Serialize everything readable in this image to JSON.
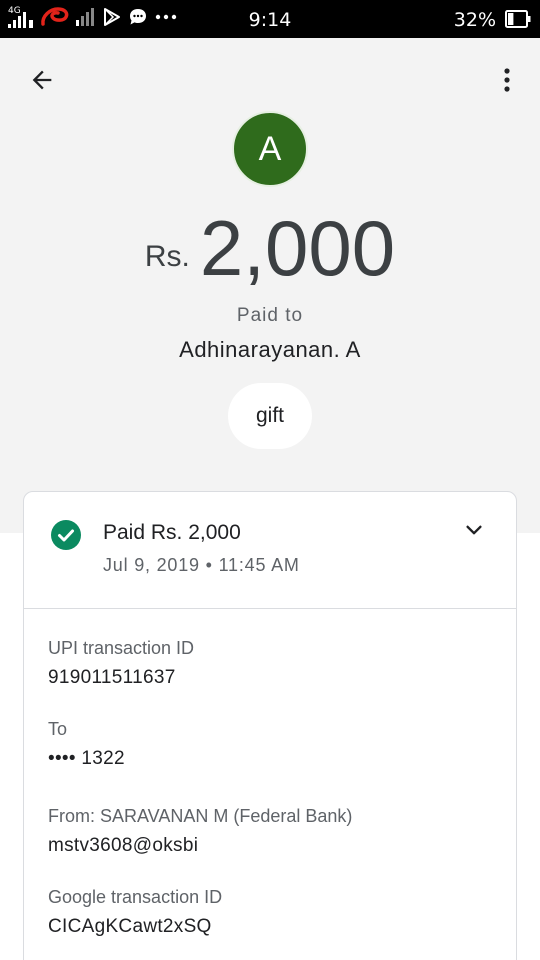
{
  "status_bar": {
    "network_label": "4G",
    "time": "9:14",
    "battery_percent": "32%",
    "battery_level": 0.32,
    "icons": [
      "signal-4g-icon",
      "airtel-icon",
      "signal-bars-icon",
      "play-store-icon",
      "message-icon",
      "more-notifications-icon",
      "battery-icon"
    ]
  },
  "header": {
    "back_icon": "arrow-back-icon",
    "menu_icon": "more-vert-icon",
    "avatar_initial": "A",
    "avatar_color": "#2f6b1c",
    "currency": "Rs.",
    "amount": "2,000",
    "paid_to_label": "Paid to",
    "payee_name": "Adhinarayanan. A",
    "note": "gift"
  },
  "summary": {
    "status_icon": "check-circle-icon",
    "status_color": "#0b8a60",
    "title": "Paid Rs. 2,000",
    "datetime": "Jul 9, 2019 • 11:45 AM",
    "expand_icon": "chevron-down-icon"
  },
  "details": [
    {
      "label": "UPI transaction ID",
      "value": "919011511637"
    },
    {
      "label": "To",
      "value": "•••• 1322"
    },
    {
      "label": "From: SARAVANAN M (Federal Bank)",
      "value": "mstv3608@oksbi"
    },
    {
      "label": "Google transaction ID",
      "value": "CICAgKCawt2xSQ"
    }
  ]
}
